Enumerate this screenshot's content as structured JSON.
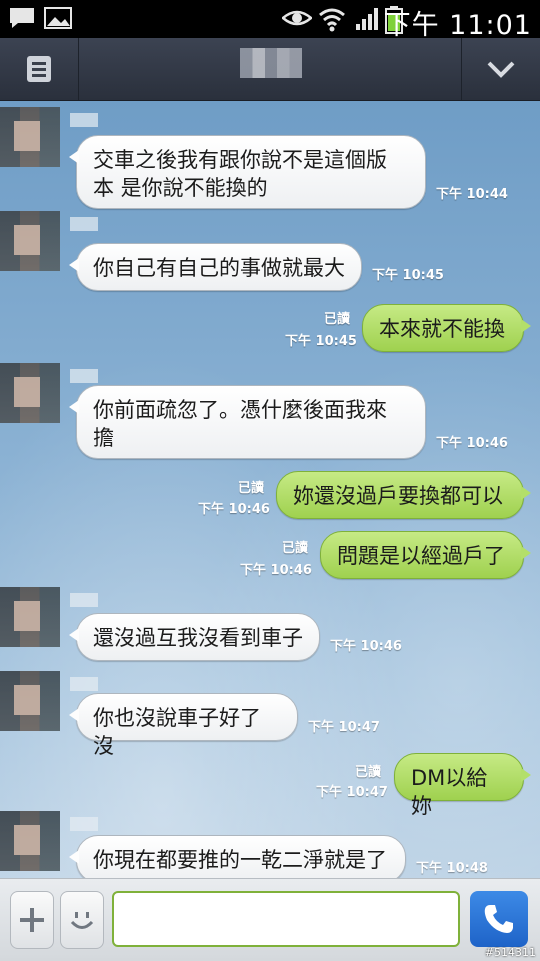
{
  "status_bar": {
    "time": "下午 11:01"
  },
  "header": {
    "menu_icon": "list-icon",
    "collapse_icon": "chevron-down-icon"
  },
  "messages": [
    {
      "side": "in",
      "text": "交車之後我有跟你說不是這個版本 是你說不能換的",
      "line1": "交車之後我有跟你說不是這個版",
      "line2": "本 是你說不能換的",
      "time": "下午 10:44"
    },
    {
      "side": "in",
      "text": "你自己有自己的事做就最大",
      "time": "下午 10:45"
    },
    {
      "side": "out",
      "text": "本來就不能換",
      "read": "已讀",
      "time": "下午 10:45"
    },
    {
      "side": "in",
      "text": "你前面疏忽了。憑什麼後面我來擔",
      "line1": "你前面疏忽了。憑什麼後面我來",
      "line2": "擔",
      "time": "下午 10:46"
    },
    {
      "side": "out",
      "text": "妳還沒過戶要換都可以",
      "read": "已讀",
      "time": "下午 10:46"
    },
    {
      "side": "out",
      "text": "問題是以經過戶了",
      "read": "已讀",
      "time": "下午 10:46"
    },
    {
      "side": "in",
      "text": "還沒過互我沒看到車子",
      "time": "下午 10:46"
    },
    {
      "side": "in",
      "text": "你也沒說車子好了沒",
      "time": "下午 10:47"
    },
    {
      "side": "out",
      "text": "DM以給妳",
      "read": "已讀",
      "time": "下午 10:47"
    },
    {
      "side": "in",
      "text": "你現在都要推的一乾二淨就是了",
      "time": "下午 10:48"
    }
  ],
  "input_bar": {
    "placeholder": "",
    "add_icon": "plus-icon",
    "emoji_icon": "smiley-icon",
    "call_icon": "phone-icon"
  },
  "watermark": "#514311",
  "colors": {
    "outgoing_bubble": "#b3df6a",
    "incoming_bubble": "#ffffff",
    "header": "#333946",
    "call_button": "#2a74d8"
  }
}
